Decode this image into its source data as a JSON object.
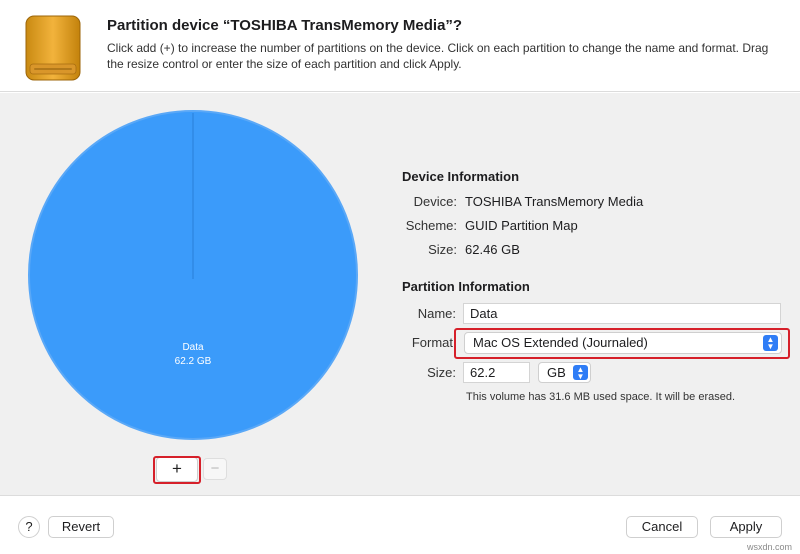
{
  "header": {
    "title": "Partition device “TOSHIBA TransMemory Media”?",
    "description": "Click add (+) to increase the number of partitions on the device. Click on each partition to change the name and format. Drag the resize control or enter the size of each partition and click Apply.",
    "icon": "external-drive-icon"
  },
  "chart_data": {
    "type": "pie",
    "slices": [
      {
        "name": "Data",
        "label": "62.2 GB",
        "value": 62.2
      }
    ],
    "colors": [
      "#3b9bfa"
    ]
  },
  "partition_controls": {
    "add_label": "+",
    "remove_label": "−"
  },
  "device_info": {
    "heading": "Device Information",
    "rows": [
      {
        "label": "Device:",
        "value": "TOSHIBA TransMemory Media"
      },
      {
        "label": "Scheme:",
        "value": "GUID Partition Map"
      },
      {
        "label": "Size:",
        "value": "62.46 GB"
      }
    ]
  },
  "partition_info": {
    "heading": "Partition Information",
    "name_label": "Name:",
    "name_value": "Data",
    "format_label": "Format",
    "format_value": "Mac OS Extended (Journaled)",
    "size_label": "Size:",
    "size_value": "62.2",
    "unit_value": "GB",
    "note": "This volume has 31.6 MB used space. It will be erased."
  },
  "footer": {
    "help_label": "?",
    "revert_label": "Revert",
    "cancel_label": "Cancel",
    "apply_label": "Apply"
  },
  "watermark": "wsxdn.com",
  "colors": {
    "accent": "#2f7df6",
    "highlight": "#d6202a",
    "pie": "#3b9bfa"
  }
}
